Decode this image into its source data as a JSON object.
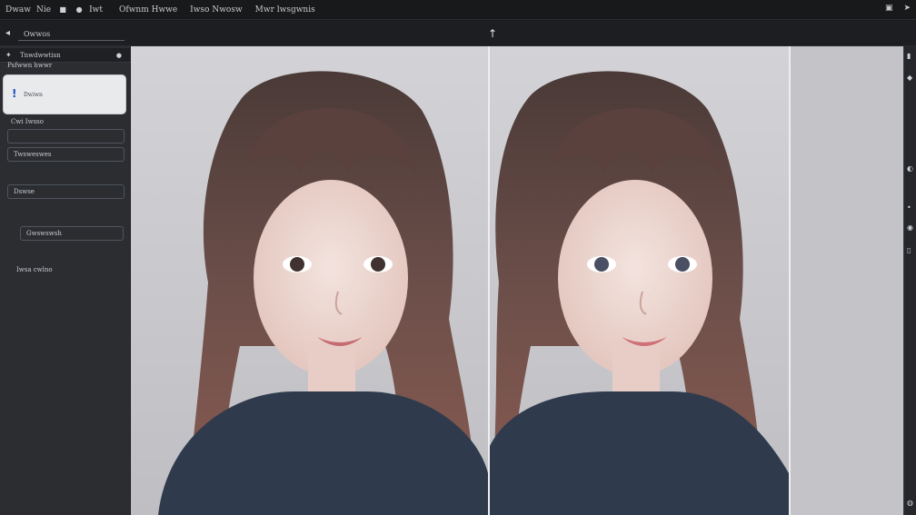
{
  "topbar": {
    "items": [
      "Dwaw",
      "Nie",
      "Iwt",
      "Ofwnm Hwwe",
      "Iwso Nwosw",
      "Mwr lwsgwnis"
    ],
    "right_icons": [
      "check-icon",
      "arrow-icon"
    ]
  },
  "subbar": {
    "title": "Owwos",
    "center_icon_label": "↑"
  },
  "sidebar": {
    "header_row_label": "Tnwdwwtisn",
    "sub_label": "Psfwwn hwwr",
    "card_label": "Dwiwn",
    "fields": [
      {
        "label": "Cwi Iwsso",
        "value": ""
      },
      {
        "label": "",
        "value": "Twsweswes"
      },
      {
        "label": "",
        "value": "Dswse"
      },
      {
        "label": "",
        "value": "Gwswswsh"
      }
    ],
    "footer_label": "Iwsa cwlno"
  },
  "canvas": {
    "comparison": "before-after",
    "panels": [
      "left",
      "right"
    ]
  },
  "colors": {
    "background": "#1b1c1f",
    "sidebar": "#2b2d31",
    "canvas": "#c9c9cd",
    "accent": "#1d4fc2"
  }
}
